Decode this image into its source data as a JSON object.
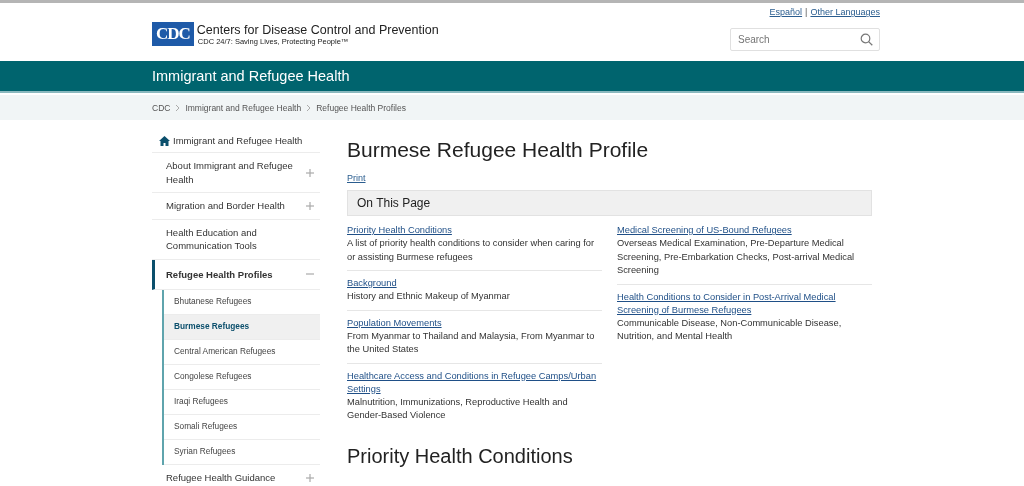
{
  "top_links": {
    "items": [
      {
        "label": "Español"
      },
      {
        "label": "Other Languages"
      }
    ],
    "separator": "|"
  },
  "header": {
    "logo_text": "CDC",
    "org_name": "Centers for Disease Control and Prevention",
    "tagline": "CDC 24/7: Saving Lives, Protecting People™"
  },
  "search": {
    "placeholder": "Search"
  },
  "site_title": "Immigrant and Refugee Health",
  "breadcrumb": [
    "CDC",
    "Immigrant and Refugee Health",
    "Refugee Health Profiles"
  ],
  "sidebar": {
    "home": "Immigrant and Refugee Health",
    "items": [
      {
        "label": "About Immigrant and Refugee Health",
        "expandable": true,
        "selected": false
      },
      {
        "label": "Migration and Border Health",
        "expandable": true,
        "selected": false
      },
      {
        "label": "Health Education and Communication Tools",
        "expandable": false,
        "selected": false
      },
      {
        "label": "Refugee Health Profiles",
        "expandable": true,
        "selected": true,
        "children": [
          {
            "label": "Bhutanese Refugees",
            "selected": false
          },
          {
            "label": "Burmese Refugees",
            "selected": true
          },
          {
            "label": "Central American Refugees",
            "selected": false
          },
          {
            "label": "Congolese Refugees",
            "selected": false
          },
          {
            "label": "Iraqi Refugees",
            "selected": false
          },
          {
            "label": "Somali Refugees",
            "selected": false
          },
          {
            "label": "Syrian Refugees",
            "selected": false
          }
        ]
      },
      {
        "label": "Refugee Health Guidance",
        "expandable": true,
        "selected": false
      }
    ]
  },
  "page": {
    "title": "Burmese Refugee Health Profile",
    "print_link": "Print",
    "on_this_page": {
      "title": "On This Page",
      "columns": [
        [
          {
            "link": "Priority Health Conditions",
            "description": "A list of priority health conditions to consider when caring for or assisting Burmese refugees"
          },
          {
            "link": "Background",
            "description": "History and Ethnic Makeup of Myanmar"
          },
          {
            "link": "Population Movements",
            "description": "From Myanmar to Thailand and Malaysia, From Myanmar to the United States"
          },
          {
            "link": "Healthcare Access and Conditions in Refugee Camps/Urban Settings",
            "description": "Malnutrition, Immunizations, Reproductive Health and Gender-Based Violence"
          }
        ],
        [
          {
            "link": "Medical Screening of US-Bound Refugees",
            "description": "Overseas Medical Examination, Pre-Departure Medical Screening, Pre-Embarkation Checks, Post-arrival Medical Screening"
          },
          {
            "link": "Health Conditions to Consider in Post-Arrival Medical Screening of Burmese Refugees",
            "description": "Communicable Disease, Non-Communicable Disease, Nutrition, and Mental Health"
          }
        ]
      ]
    },
    "next_heading": "Priority Health Conditions"
  }
}
